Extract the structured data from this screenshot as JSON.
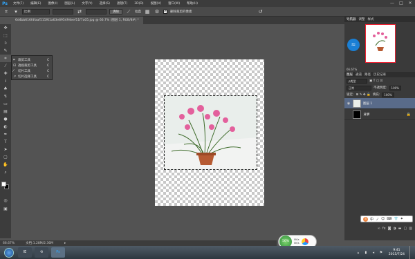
{
  "app": {
    "logo": "Ps"
  },
  "menu": [
    "文件(F)",
    "编辑(E)",
    "图像(I)",
    "图层(L)",
    "文字(Y)",
    "选择(S)",
    "滤镜(T)",
    "3D(D)",
    "视图(V)",
    "窗口(W)",
    "帮助(H)"
  ],
  "window_controls": [
    "—",
    "□",
    "✕"
  ],
  "options": {
    "ratio_select": "比例",
    "clear_button": "清除",
    "straighten_label": "拉直",
    "delete_cropped_label": "删除裁剪的像素"
  },
  "document": {
    "tab_label": "6d4bb616fdfaaf515f61a63e895494eef11f7a05.jpg @ 66.7% (图层 1, RGB/8#) *",
    "zoom": "66.67%",
    "doc_size": "文档:1.28M/2.36M"
  },
  "flyout": [
    {
      "label": "裁剪工具",
      "key": "C",
      "icon": "crop-icon"
    },
    {
      "label": "透视裁剪工具",
      "key": "C",
      "icon": "perspective-crop-icon"
    },
    {
      "label": "切片工具",
      "key": "C",
      "icon": "slice-icon"
    },
    {
      "label": "切片选择工具",
      "key": "C",
      "icon": "slice-select-icon"
    }
  ],
  "top_panel_tabs": [
    "导航器",
    "调整",
    "样式"
  ],
  "navigator_zoom": "66.67%",
  "layers_panel": {
    "tabs": [
      "图层",
      "通道",
      "路径",
      "历史记录"
    ],
    "filter_label": "ρ类型",
    "blend_mode": "正常",
    "opacity_label": "不透明度:",
    "opacity_value": "100%",
    "lock_label": "锁定:",
    "fill_label": "填充:",
    "fill_value": "100%",
    "layers": [
      {
        "name": "图层 1",
        "selected": true,
        "thumb": "flower"
      },
      {
        "name": "背景",
        "selected": false,
        "thumb": "black"
      }
    ]
  },
  "ime": {
    "logo": "S",
    "items": [
      "中",
      "ノ",
      "☺",
      "⌨",
      "👕",
      "✦"
    ]
  },
  "netmon": {
    "percent": "56%",
    "up": "0K/s",
    "down": "0K/s"
  },
  "taskbar": {
    "apps": [
      "IE",
      "⟲",
      "Ps"
    ],
    "clock_time": "9:41",
    "clock_date": "2015/7/24"
  },
  "colors": {
    "accent": "#31a8ff",
    "selected_layer": "#596b8a"
  }
}
